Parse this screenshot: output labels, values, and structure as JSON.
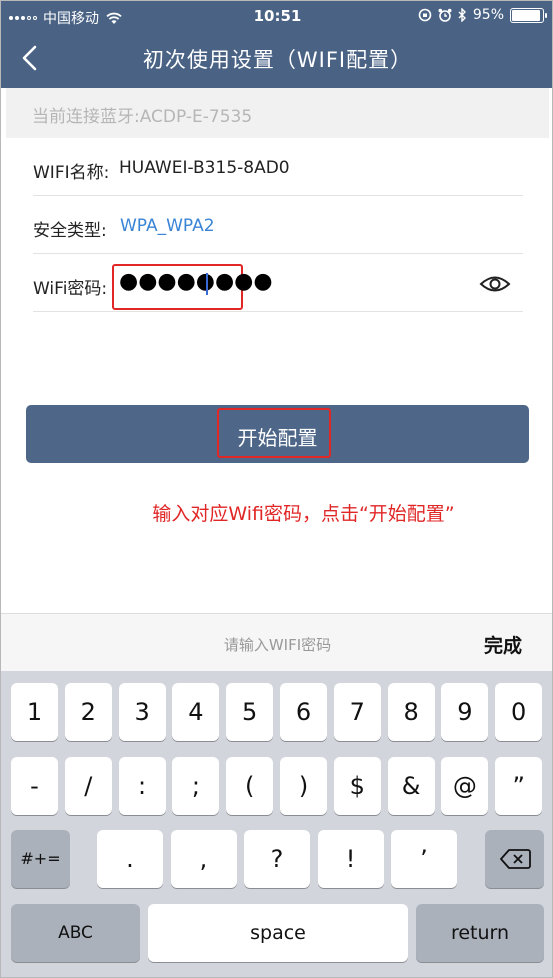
{
  "status_bar": {
    "carrier": "中国移动",
    "time": "10:51",
    "battery_text": "95%",
    "battery_level": 0.95
  },
  "nav": {
    "title": "初次使用设置（WIFI配置）"
  },
  "bluetooth_row": {
    "text": "当前连接蓝牙:ACDP-E-7535"
  },
  "form": {
    "ssid_label": "WIFI名称:",
    "ssid_value": "HUAWEI-B315-8AD0",
    "security_label": "安全类型:",
    "security_value": "WPA_WPA2",
    "password_label": "WiFi密码:",
    "password_masked": "●●●●●●●●"
  },
  "start_button": {
    "label": "开始配置"
  },
  "instruction_note": "输入对应Wifi密码，点击“开始配置”",
  "keyboard": {
    "placeholder": "请输入WIFI密码",
    "done_label": "完成",
    "row1": [
      "1",
      "2",
      "3",
      "4",
      "5",
      "6",
      "7",
      "8",
      "9",
      "0"
    ],
    "row2": [
      "-",
      "/",
      ":",
      ";",
      "(",
      ")",
      "$",
      "&",
      "@",
      "”"
    ],
    "row3_mode": "#+=",
    "row3": [
      ".",
      ",",
      "?",
      "!",
      "’"
    ],
    "abc_label": "ABC",
    "space_label": "space",
    "return_label": "return"
  },
  "colors": {
    "nav_bg": "#4a6385",
    "button_bg": "#4e6788",
    "highlight_red": "#e12626",
    "link_blue": "#3a84d6"
  }
}
